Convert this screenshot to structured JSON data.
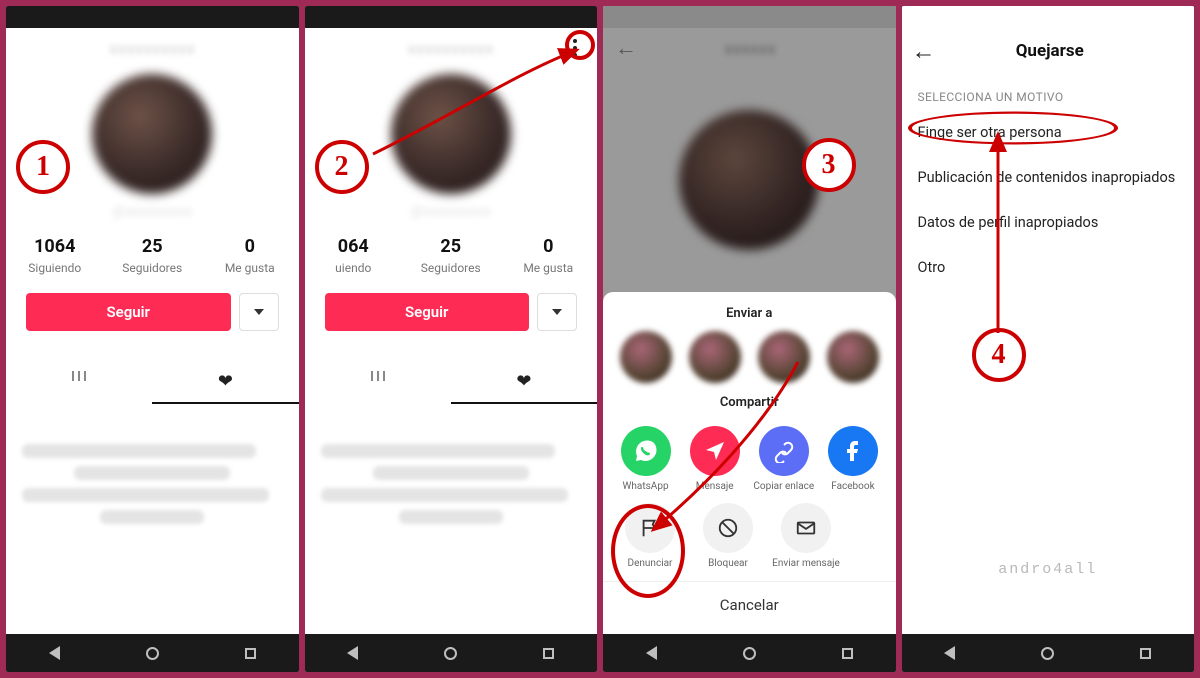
{
  "screens": {
    "s1": {
      "username_blur": "username",
      "stats": {
        "following_n": "1064",
        "following_l": "Siguiendo",
        "followers_n": "25",
        "followers_l": "Seguidores",
        "likes_n": "0",
        "likes_l": "Me gusta"
      },
      "follow_btn": "Seguir"
    },
    "s2": {
      "stats": {
        "following_n": "064",
        "following_l": "uiendo",
        "followers_n": "25",
        "followers_l": "Seguidores",
        "likes_n": "0",
        "likes_l": "Me gusta"
      },
      "follow_btn": "Seguir"
    },
    "s3": {
      "send_to": "Enviar a",
      "share": "Compartir",
      "shares": {
        "whatsapp": "WhatsApp",
        "message": "Mensaje",
        "copy": "Copiar enlace",
        "facebook": "Facebook"
      },
      "actions": {
        "report": "Denunciar",
        "block": "Bloquear",
        "sendmsg": "Enviar mensaje"
      },
      "cancel": "Cancelar"
    },
    "s4": {
      "title": "Quejarse",
      "section": "SELECCIONA UN MOTIVO",
      "o1": "Finge ser otra persona",
      "o2": "Publicación de contenidos inapropiados",
      "o3": "Datos de perfil inapropiados",
      "o4": "Otro",
      "watermark": "andro4all"
    }
  },
  "badges": {
    "b1": "1",
    "b2": "2",
    "b3": "3",
    "b4": "4"
  },
  "colors": {
    "accent": "#fe2c55",
    "ring": "#c00",
    "whatsapp": "#25D366",
    "telegramish": "#fe2c55",
    "link": "#5b6ef5",
    "facebook": "#1877f2"
  }
}
